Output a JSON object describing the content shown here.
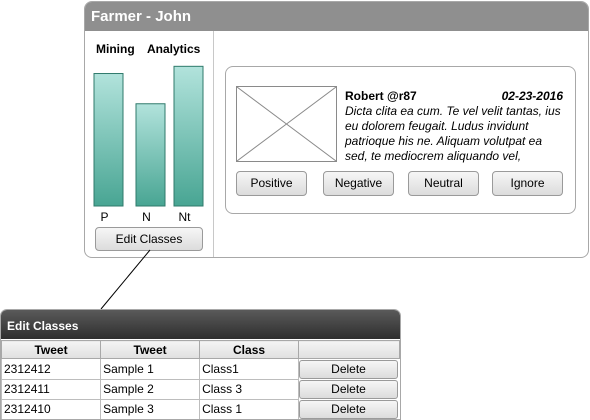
{
  "main_window": {
    "title": "Farmer - John"
  },
  "chart_data": {
    "type": "bar",
    "categories": [
      "P",
      "N",
      "Nt"
    ],
    "values": [
      0.92,
      0.71,
      0.97
    ],
    "header_labels": [
      "Mining",
      "Analytics"
    ],
    "bar_color_top": "#b2e3dc",
    "bar_color_bottom": "#48a593",
    "bar_border": "#2f7a6b"
  },
  "left_panel": {
    "edit_classes_label": "Edit Classes"
  },
  "tweet": {
    "user": "Robert @r87",
    "date": "02-23-2016",
    "text": "Dicta clita ea cum. Te vel velit tantas, ius eu dolorem feugait. Ludus invidunt patrioque his ne. Aliquam volutpat ea sed, te mediocrem aliquando vel,",
    "avatar_icon": "image-placeholder-icon",
    "buttons": [
      {
        "label": "Positive"
      },
      {
        "label": "Negative"
      },
      {
        "label": "Neutral"
      },
      {
        "label": "Ignore"
      }
    ]
  },
  "edit_classes_panel": {
    "title": "Edit Classes",
    "columns": [
      "Tweet",
      "Tweet",
      "Class",
      ""
    ],
    "rows": [
      {
        "id": "2312412",
        "tweet": "Sample 1",
        "class": "Class1",
        "action": "Delete"
      },
      {
        "id": "2312411",
        "tweet": "Sample 2",
        "class": "Class 3",
        "action": "Delete"
      },
      {
        "id": "2312410",
        "tweet": "Sample 3",
        "class": "Class 1",
        "action": "Delete"
      }
    ]
  }
}
